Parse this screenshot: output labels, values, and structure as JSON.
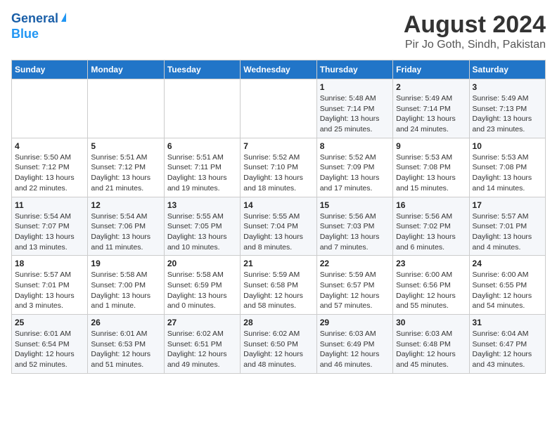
{
  "header": {
    "logo_line1": "General",
    "logo_line2": "Blue",
    "title": "August 2024",
    "subtitle": "Pir Jo Goth, Sindh, Pakistan"
  },
  "calendar": {
    "headers": [
      "Sunday",
      "Monday",
      "Tuesday",
      "Wednesday",
      "Thursday",
      "Friday",
      "Saturday"
    ],
    "weeks": [
      [
        {
          "day": "",
          "info": ""
        },
        {
          "day": "",
          "info": ""
        },
        {
          "day": "",
          "info": ""
        },
        {
          "day": "",
          "info": ""
        },
        {
          "day": "1",
          "info": "Sunrise: 5:48 AM\nSunset: 7:14 PM\nDaylight: 13 hours and 25 minutes."
        },
        {
          "day": "2",
          "info": "Sunrise: 5:49 AM\nSunset: 7:14 PM\nDaylight: 13 hours and 24 minutes."
        },
        {
          "day": "3",
          "info": "Sunrise: 5:49 AM\nSunset: 7:13 PM\nDaylight: 13 hours and 23 minutes."
        }
      ],
      [
        {
          "day": "4",
          "info": "Sunrise: 5:50 AM\nSunset: 7:12 PM\nDaylight: 13 hours and 22 minutes."
        },
        {
          "day": "5",
          "info": "Sunrise: 5:51 AM\nSunset: 7:12 PM\nDaylight: 13 hours and 21 minutes."
        },
        {
          "day": "6",
          "info": "Sunrise: 5:51 AM\nSunset: 7:11 PM\nDaylight: 13 hours and 19 minutes."
        },
        {
          "day": "7",
          "info": "Sunrise: 5:52 AM\nSunset: 7:10 PM\nDaylight: 13 hours and 18 minutes."
        },
        {
          "day": "8",
          "info": "Sunrise: 5:52 AM\nSunset: 7:09 PM\nDaylight: 13 hours and 17 minutes."
        },
        {
          "day": "9",
          "info": "Sunrise: 5:53 AM\nSunset: 7:08 PM\nDaylight: 13 hours and 15 minutes."
        },
        {
          "day": "10",
          "info": "Sunrise: 5:53 AM\nSunset: 7:08 PM\nDaylight: 13 hours and 14 minutes."
        }
      ],
      [
        {
          "day": "11",
          "info": "Sunrise: 5:54 AM\nSunset: 7:07 PM\nDaylight: 13 hours and 13 minutes."
        },
        {
          "day": "12",
          "info": "Sunrise: 5:54 AM\nSunset: 7:06 PM\nDaylight: 13 hours and 11 minutes."
        },
        {
          "day": "13",
          "info": "Sunrise: 5:55 AM\nSunset: 7:05 PM\nDaylight: 13 hours and 10 minutes."
        },
        {
          "day": "14",
          "info": "Sunrise: 5:55 AM\nSunset: 7:04 PM\nDaylight: 13 hours and 8 minutes."
        },
        {
          "day": "15",
          "info": "Sunrise: 5:56 AM\nSunset: 7:03 PM\nDaylight: 13 hours and 7 minutes."
        },
        {
          "day": "16",
          "info": "Sunrise: 5:56 AM\nSunset: 7:02 PM\nDaylight: 13 hours and 6 minutes."
        },
        {
          "day": "17",
          "info": "Sunrise: 5:57 AM\nSunset: 7:01 PM\nDaylight: 13 hours and 4 minutes."
        }
      ],
      [
        {
          "day": "18",
          "info": "Sunrise: 5:57 AM\nSunset: 7:01 PM\nDaylight: 13 hours and 3 minutes."
        },
        {
          "day": "19",
          "info": "Sunrise: 5:58 AM\nSunset: 7:00 PM\nDaylight: 13 hours and 1 minute."
        },
        {
          "day": "20",
          "info": "Sunrise: 5:58 AM\nSunset: 6:59 PM\nDaylight: 13 hours and 0 minutes."
        },
        {
          "day": "21",
          "info": "Sunrise: 5:59 AM\nSunset: 6:58 PM\nDaylight: 12 hours and 58 minutes."
        },
        {
          "day": "22",
          "info": "Sunrise: 5:59 AM\nSunset: 6:57 PM\nDaylight: 12 hours and 57 minutes."
        },
        {
          "day": "23",
          "info": "Sunrise: 6:00 AM\nSunset: 6:56 PM\nDaylight: 12 hours and 55 minutes."
        },
        {
          "day": "24",
          "info": "Sunrise: 6:00 AM\nSunset: 6:55 PM\nDaylight: 12 hours and 54 minutes."
        }
      ],
      [
        {
          "day": "25",
          "info": "Sunrise: 6:01 AM\nSunset: 6:54 PM\nDaylight: 12 hours and 52 minutes."
        },
        {
          "day": "26",
          "info": "Sunrise: 6:01 AM\nSunset: 6:53 PM\nDaylight: 12 hours and 51 minutes."
        },
        {
          "day": "27",
          "info": "Sunrise: 6:02 AM\nSunset: 6:51 PM\nDaylight: 12 hours and 49 minutes."
        },
        {
          "day": "28",
          "info": "Sunrise: 6:02 AM\nSunset: 6:50 PM\nDaylight: 12 hours and 48 minutes."
        },
        {
          "day": "29",
          "info": "Sunrise: 6:03 AM\nSunset: 6:49 PM\nDaylight: 12 hours and 46 minutes."
        },
        {
          "day": "30",
          "info": "Sunrise: 6:03 AM\nSunset: 6:48 PM\nDaylight: 12 hours and 45 minutes."
        },
        {
          "day": "31",
          "info": "Sunrise: 6:04 AM\nSunset: 6:47 PM\nDaylight: 12 hours and 43 minutes."
        }
      ]
    ]
  }
}
